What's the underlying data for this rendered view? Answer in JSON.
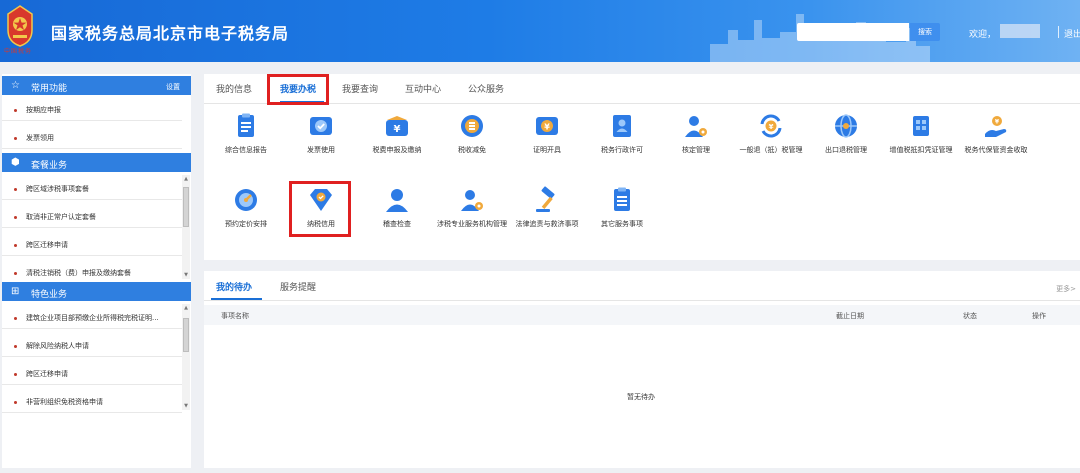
{
  "header": {
    "title": "国家税务总局北京市电子税务局",
    "emblem_text": "中国税务",
    "search_button": "搜索",
    "welcome": "欢迎，",
    "logout": "退出",
    "colors": {
      "primary": "#1769d6",
      "accent_red": "#e02020"
    }
  },
  "sidebar": {
    "common": {
      "title": "常用功能",
      "setting": "设置",
      "items": [
        {
          "label": "按期应申报"
        },
        {
          "label": "发票领用"
        }
      ]
    },
    "package": {
      "title": "套餐业务",
      "items": [
        {
          "label": "跨区域涉税事项套餐"
        },
        {
          "label": "取消非正常户认定套餐"
        },
        {
          "label": "跨区迁移申请"
        },
        {
          "label": "清税注销税（费）申报及缴纳套餐"
        }
      ]
    },
    "special": {
      "title": "特色业务",
      "items": [
        {
          "label": "建筑企业项目部预缴企业所得税完税证明..."
        },
        {
          "label": "解除风险纳税人申请"
        },
        {
          "label": "跨区迁移申请"
        },
        {
          "label": "非营利组织免税资格申请"
        }
      ]
    }
  },
  "main": {
    "tabs": [
      {
        "label": "我的信息"
      },
      {
        "label": "我要办税"
      },
      {
        "label": "我要查询"
      },
      {
        "label": "互动中心"
      },
      {
        "label": "公众服务"
      }
    ],
    "functions": [
      {
        "label": "综合信息报告",
        "icon": "report-list-icon"
      },
      {
        "label": "发票使用",
        "icon": "invoice-check-icon"
      },
      {
        "label": "税费申报及缴纳",
        "icon": "wallet-yuan-icon"
      },
      {
        "label": "税收减免",
        "icon": "coin-stack-icon"
      },
      {
        "label": "证明开具",
        "icon": "certificate-icon"
      },
      {
        "label": "税务行政许可",
        "icon": "license-person-icon"
      },
      {
        "label": "核定管理",
        "icon": "person-gear-icon"
      },
      {
        "label": "一般退（抵）税管理",
        "icon": "refund-yuan-icon"
      },
      {
        "label": "出口退税管理",
        "icon": "globe-icon"
      },
      {
        "label": "增值税抵扣凭证管理",
        "icon": "receipt-grid-icon"
      },
      {
        "label": "税务代保管资金收取",
        "icon": "hand-money-icon"
      },
      {
        "label": "预约定价安排",
        "icon": "gauge-icon"
      },
      {
        "label": "纳税信用",
        "icon": "diamond-check-icon"
      },
      {
        "label": "稽查检查",
        "icon": "person-icon"
      },
      {
        "label": "涉税专业服务机构管理",
        "icon": "person-gear-icon"
      },
      {
        "label": "法律追责与救济事项",
        "icon": "gavel-icon"
      },
      {
        "label": "其它服务事项",
        "icon": "clipboard-icon"
      }
    ]
  },
  "todo": {
    "tabs": [
      {
        "label": "我的待办"
      },
      {
        "label": "服务提醒"
      }
    ],
    "more": "更多>",
    "columns": {
      "name": "事项名称",
      "deadline": "截止日期",
      "status": "状态",
      "action": "操作"
    },
    "empty": "暂无待办"
  }
}
